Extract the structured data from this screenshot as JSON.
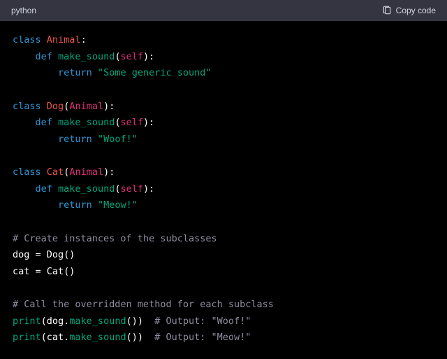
{
  "header": {
    "language": "python",
    "copy_label": "Copy code"
  },
  "code": {
    "class1": {
      "kw_class": "class",
      "name": "Animal",
      "colon": ":"
    },
    "def1": {
      "indent": "    ",
      "kw_def": "def",
      "name": "make_sound",
      "lp": "(",
      "self": "self",
      "rp_colon": "):"
    },
    "ret1": {
      "indent": "        ",
      "kw_return": "return",
      "sp": " ",
      "str": "\"Some generic sound\""
    },
    "class2": {
      "kw_class": "class",
      "name": "Dog",
      "lp": "(",
      "base": "Animal",
      "rp_colon": "):"
    },
    "def2": {
      "indent": "    ",
      "kw_def": "def",
      "name": "make_sound",
      "lp": "(",
      "self": "self",
      "rp_colon": "):"
    },
    "ret2": {
      "indent": "        ",
      "kw_return": "return",
      "sp": " ",
      "str": "\"Woof!\""
    },
    "class3": {
      "kw_class": "class",
      "name": "Cat",
      "lp": "(",
      "base": "Animal",
      "rp_colon": "):"
    },
    "def3": {
      "indent": "    ",
      "kw_def": "def",
      "name": "make_sound",
      "lp": "(",
      "self": "self",
      "rp_colon": "):"
    },
    "ret3": {
      "indent": "        ",
      "kw_return": "return",
      "sp": " ",
      "str": "\"Meow!\""
    },
    "cmt1": "# Create instances of the subclasses",
    "asgn1": {
      "lhs": "dog = ",
      "call": "Dog",
      "parens": "()"
    },
    "asgn2": {
      "lhs": "cat = ",
      "call": "Cat",
      "parens": "()"
    },
    "cmt2": "# Call the overridden method for each subclass",
    "p1": {
      "print": "print",
      "lp": "(",
      "obj": "dog.",
      "meth": "make_sound",
      "call": "()",
      "rp": ")",
      "sp": "  ",
      "cmt": "# Output: \"Woof!\""
    },
    "p2": {
      "print": "print",
      "lp": "(",
      "obj": "cat.",
      "meth": "make_sound",
      "call": "()",
      "rp": ")",
      "sp": "  ",
      "cmt": "# Output: \"Meow!\""
    }
  }
}
